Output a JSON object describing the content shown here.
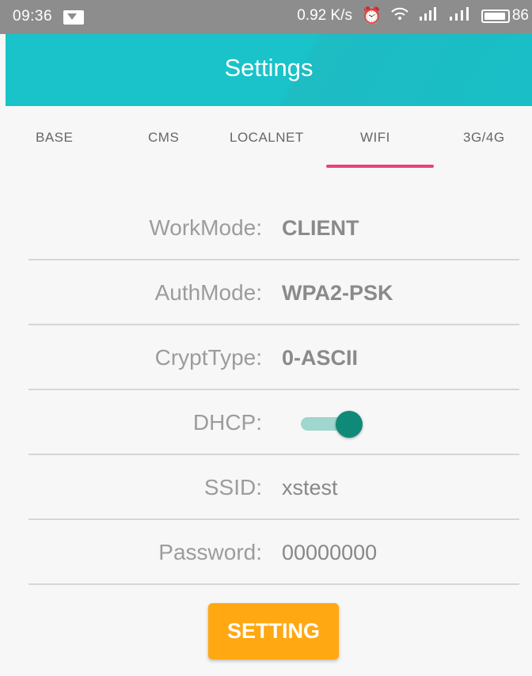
{
  "status_bar": {
    "time": "09:36",
    "speed": "0.92 K/s",
    "battery_level": "86",
    "icons": [
      "message-icon",
      "alarm-icon",
      "wifi-icon",
      "signal-icon",
      "signal-icon",
      "battery-icon"
    ]
  },
  "app_bar": {
    "title": "Settings",
    "color": "#19c3c9"
  },
  "tabs": [
    {
      "label": "BASE",
      "selected": false
    },
    {
      "label": "CMS",
      "selected": false
    },
    {
      "label": "LOCALNET",
      "selected": false
    },
    {
      "label": "WIFI",
      "selected": true
    },
    {
      "label": "3G/4G",
      "selected": false
    }
  ],
  "tab_indicator_color": "#ec407a",
  "form": {
    "workmode": {
      "label": "WorkMode:",
      "value": "CLIENT"
    },
    "authmode": {
      "label": "AuthMode:",
      "value": "WPA2-PSK"
    },
    "crypttype": {
      "label": "CryptType:",
      "value": "0-ASCII"
    },
    "dhcp": {
      "label": "DHCP:",
      "enabled": true
    },
    "ssid": {
      "label": "SSID:",
      "value": "xstest"
    },
    "password": {
      "label": "Password:",
      "value": "00000000"
    }
  },
  "button": {
    "label": "SETTING",
    "color": "#ffa811"
  }
}
